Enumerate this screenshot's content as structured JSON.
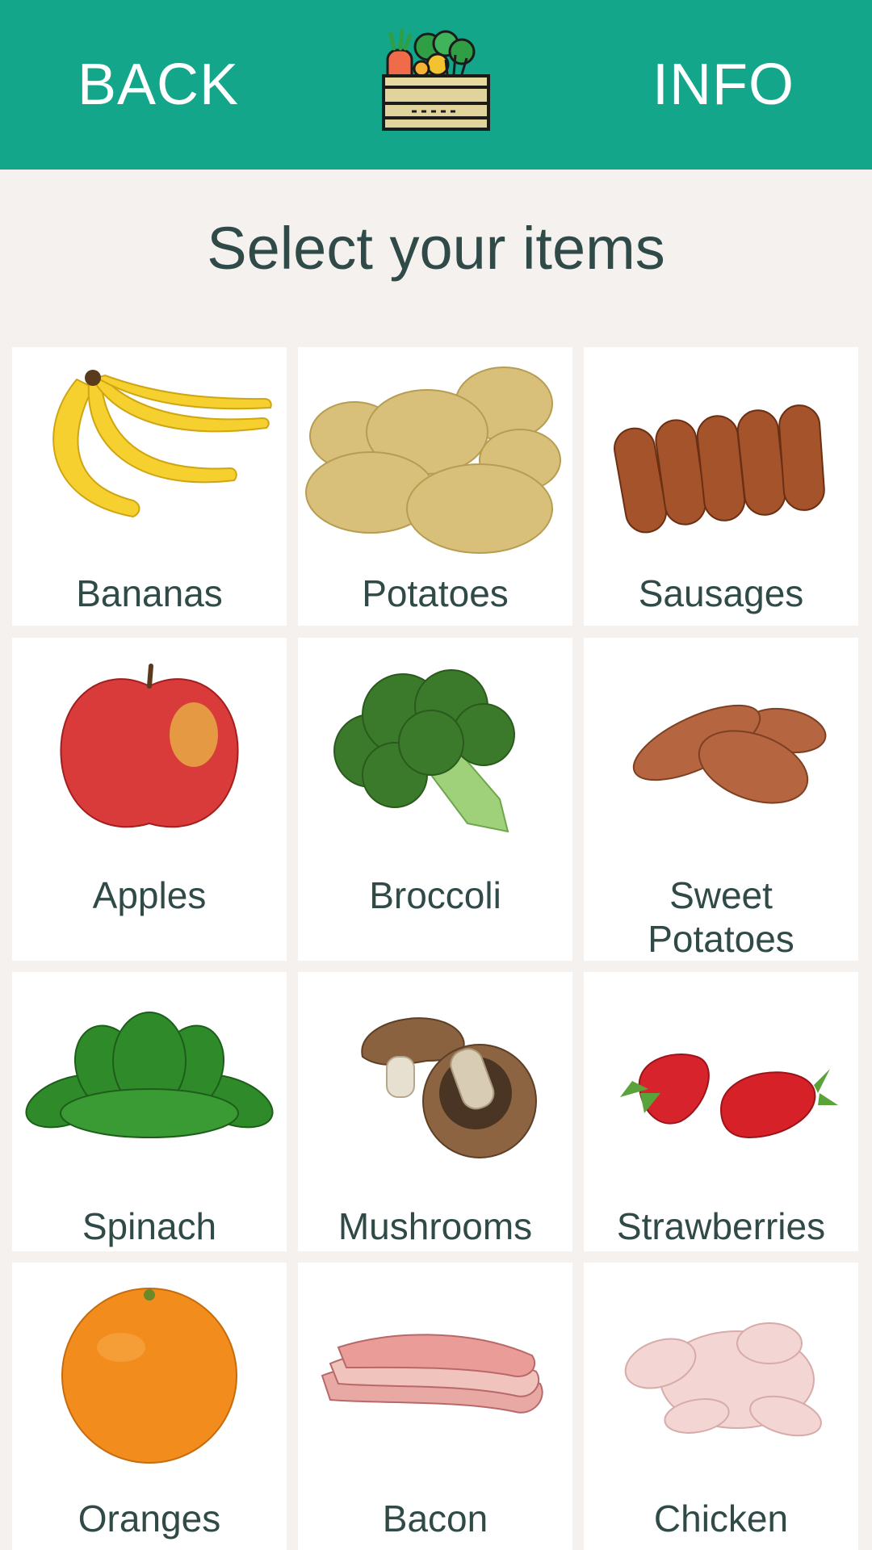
{
  "header": {
    "back_label": "BACK",
    "info_label": "INFO",
    "logo_icon": "vegetable-crate-icon",
    "bg_color": "#13a68a"
  },
  "page": {
    "title": "Select your items"
  },
  "items": [
    {
      "label": "Bananas",
      "icon": "banana-icon"
    },
    {
      "label": "Potatoes",
      "icon": "potato-icon"
    },
    {
      "label": "Sausages",
      "icon": "sausage-icon"
    },
    {
      "label": "Apples",
      "icon": "apple-icon"
    },
    {
      "label": "Broccoli",
      "icon": "broccoli-icon"
    },
    {
      "label": "Sweet\nPotatoes",
      "icon": "sweet-potato-icon"
    },
    {
      "label": "Spinach",
      "icon": "spinach-icon"
    },
    {
      "label": "Mushrooms",
      "icon": "mushroom-icon"
    },
    {
      "label": "Strawberries",
      "icon": "strawberry-icon"
    },
    {
      "label": "Oranges",
      "icon": "orange-icon"
    },
    {
      "label": "Bacon",
      "icon": "bacon-icon"
    },
    {
      "label": "Chicken",
      "icon": "chicken-icon"
    }
  ]
}
